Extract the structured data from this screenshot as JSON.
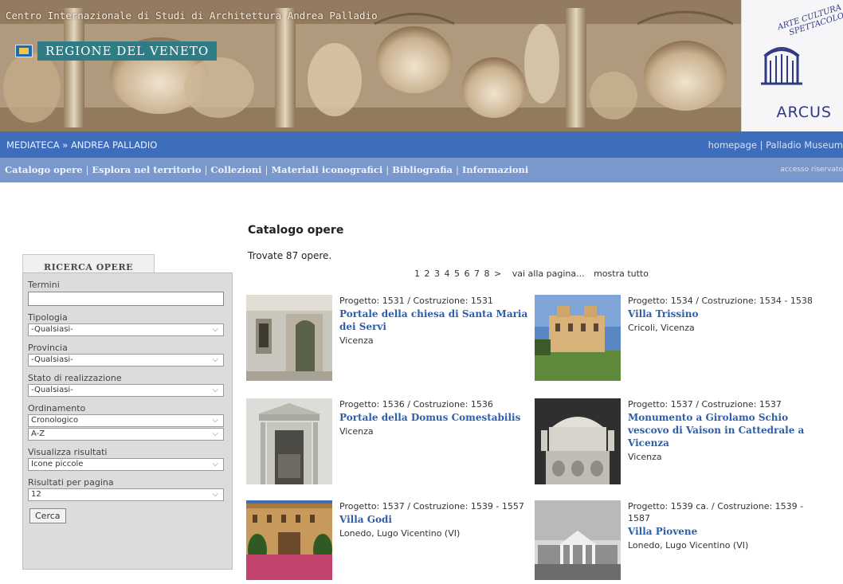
{
  "header": {
    "institution": "Centro Internazionale di Studi di Architettura Andrea Palladio",
    "regione_label": "REGIONE DEL VENETO",
    "arcus_motto": "ARTE CULTURA SPETTACOLO",
    "arcus_logo": "ARCUS"
  },
  "navbar": {
    "breadcrumb": "MEDIATECA » ANDREA PALLADIO",
    "right_links": "homepage | Palladio Museum"
  },
  "menu": {
    "items": [
      "Catalogo opere",
      "Esplora nel territorio",
      "Collezioni",
      "Materiali iconografici",
      "Bibliografia",
      "Informazioni"
    ],
    "accesso": "accesso riservato"
  },
  "sidebar": {
    "tab_label": "RICERCA OPERE",
    "termini_label": "Termini",
    "termini_value": "",
    "tipologia_label": "Tipologia",
    "tipologia_value": "-Qualsiasi-",
    "provincia_label": "Provincia",
    "provincia_value": "-Qualsiasi-",
    "stato_label": "Stato di realizzazione",
    "stato_value": "-Qualsiasi-",
    "ordinamento_label": "Ordinamento",
    "ordinamento_value": "Cronologico",
    "ordine_value": "A-Z",
    "visualizza_label": "Visualizza risultati",
    "visualizza_value": "Icone piccole",
    "per_pagina_label": "Risultati per pagina",
    "per_pagina_value": "12",
    "cerca_label": "Cerca"
  },
  "main": {
    "title": "Catalogo opere",
    "found": "Trovate 87 opere.",
    "pages": [
      "1",
      "2",
      "3",
      "4",
      "5",
      "6",
      "7",
      "8",
      ">"
    ],
    "goto": "vai alla pagina...",
    "show_all": "mostra tutto"
  },
  "results": [
    {
      "dates": "Progetto: 1531 / Costruzione: 1531",
      "title": "Portale della chiesa di Santa Maria dei Servi",
      "place": "Vicenza"
    },
    {
      "dates": "Progetto: 1534 / Costruzione: 1534 - 1538",
      "title": "Villa Trissino",
      "place": "Cricoli, Vicenza"
    },
    {
      "dates": "Progetto: 1536 / Costruzione: 1536",
      "title": "Portale della Domus Comestabilis",
      "place": "Vicenza"
    },
    {
      "dates": "Progetto: 1537 / Costruzione: 1537",
      "title": "Monumento a Girolamo Schio vescovo di Vaison in Cattedrale a Vicenza",
      "place": "Vicenza"
    },
    {
      "dates": "Progetto: 1537 / Costruzione: 1539 - 1557",
      "title": "Villa Godi",
      "place": "Lonedo, Lugo Vicentino (VI)"
    },
    {
      "dates": "Progetto: 1539 ca. / Costruzione: 1539 - 1587",
      "title": "Villa Piovene",
      "place": "Lonedo, Lugo Vicentino (VI)"
    }
  ],
  "colors": {
    "nav_primary": "#3d6dbb",
    "nav_secondary": "#7a98cc",
    "link_title": "#2d5ea8",
    "sidebar_bg": "#dcdcdc"
  }
}
